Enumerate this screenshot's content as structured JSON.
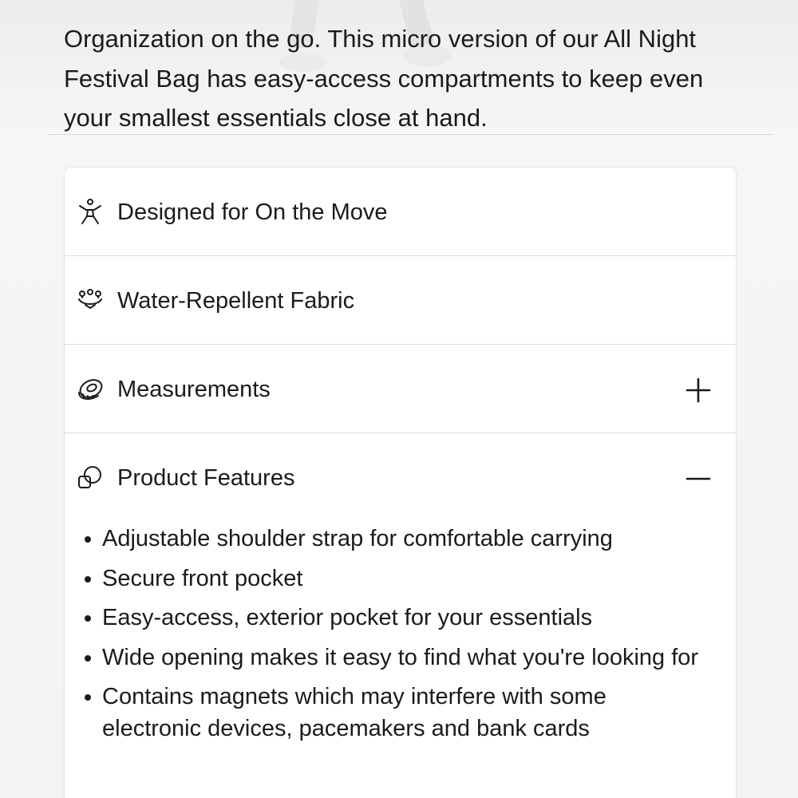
{
  "intro": {
    "description": "Organization on the go. This micro version of our All Night Festival Bag has easy-access compartments to keep even your smallest essentials close at hand."
  },
  "accordion": {
    "items": [
      {
        "label": "Designed for On the Move",
        "icon": "person-moving-icon",
        "toggle": null
      },
      {
        "label": "Water-Repellent Fabric",
        "icon": "water-drops-icon",
        "toggle": null
      },
      {
        "label": "Measurements",
        "icon": "measuring-tape-icon",
        "toggle": "plus-icon"
      },
      {
        "label": "Product Features",
        "icon": "overlapping-shapes-icon",
        "toggle": "minus-icon"
      }
    ],
    "features": [
      "Adjustable shoulder strap for comfortable carrying",
      "Secure front pocket",
      "Easy-access, exterior pocket for your essentials",
      "Wide opening makes it easy to find what you're looking for",
      "Contains magnets which may interfere with some electronic devices, pacemakers and bank cards"
    ]
  },
  "colors": {
    "text": "#1b1b1b",
    "card": "#ffffff",
    "divider": "#dedede",
    "page": "#f3f3f3"
  }
}
